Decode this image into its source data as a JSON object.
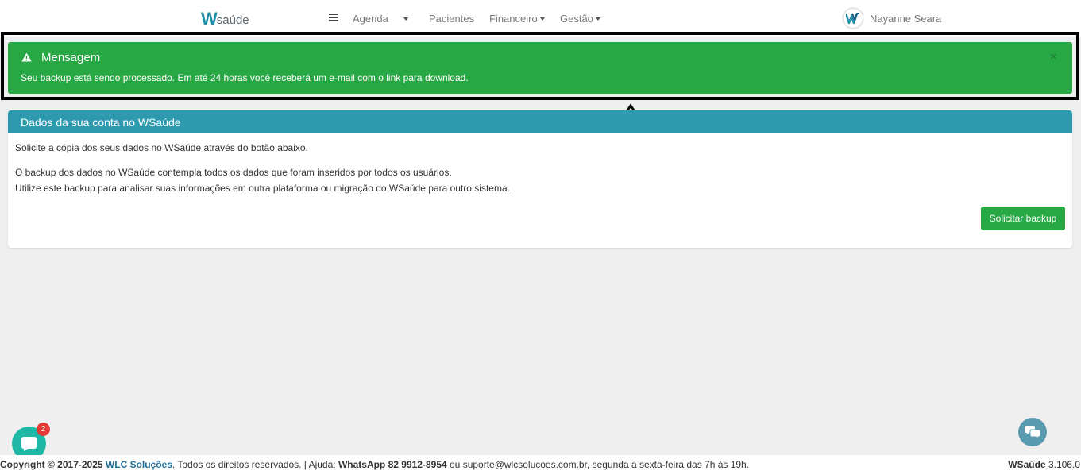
{
  "navbar": {
    "logo_w": "W",
    "logo_text": "saúde",
    "menu": {
      "agenda": "Agenda",
      "pacientes": "Pacientes",
      "financeiro": "Financeiro",
      "gestao": "Gestão"
    },
    "user_name": "Nayanne Seara"
  },
  "alert": {
    "title": "Mensagem",
    "text": "Seu backup está sendo processado. Em até 24 horas você receberá um e-mail com o link para download.",
    "close": "×",
    "color": "#28a745"
  },
  "card": {
    "header": "Dados da sua conta no WSaúde",
    "line1": "Solicite a cópia dos seus dados no WSaúde através do botão abaixo.",
    "line2": "O backup dos dados no WSaúde contempla todos os dados que foram inseridos por todos os usuários.",
    "line3": "Utilize este backup para analisar suas informações em outra plataforma ou migração do WSaúde para outro sistema.",
    "button": "Solicitar backup",
    "header_color": "#2e9aad"
  },
  "chat": {
    "badge": "2"
  },
  "footer": {
    "copyright": "Copyright © 2017-2025",
    "company": "WLC Soluções",
    "rights": ". Todos os direitos reservados. | Ajuda: ",
    "whatsapp": "WhatsApp 82 9912-8954",
    "support": " ou suporte@wlcsolucoes.com.br, segunda a sexta-feira das 7h às 19h.",
    "app_name": "WSaúde",
    "version": "3.106.0"
  }
}
